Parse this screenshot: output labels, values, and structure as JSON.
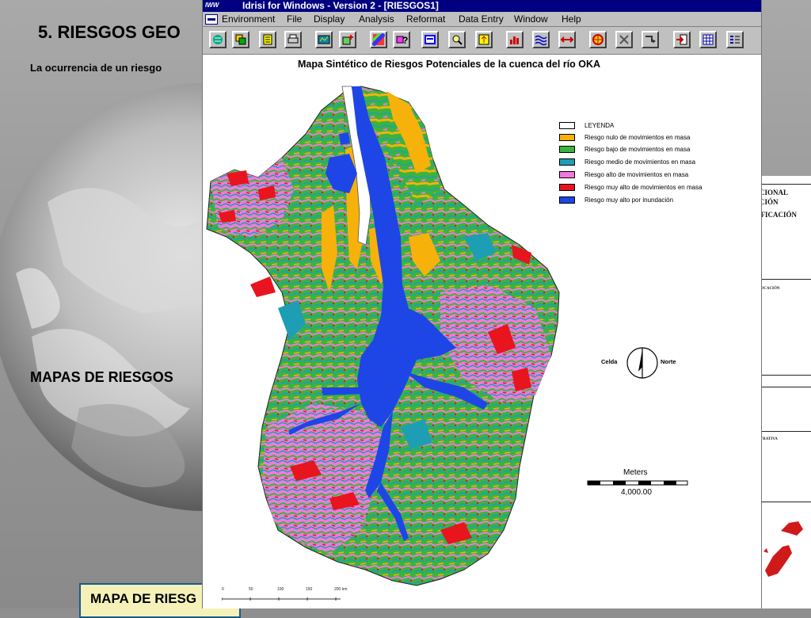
{
  "slide": {
    "title": "5. RIESGOS GEO",
    "intro": "La ocurrencia de un riesgo",
    "heading": "MAPAS DE RIESGOS",
    "bottom_label": "MAPA DE RIESG"
  },
  "window": {
    "title": "Idrisi for Windows - Version 2 - [RIESGOS1]",
    "app_icon_text": "IWW",
    "menus": [
      "Environment",
      "File",
      "Display",
      "Analysis",
      "Reformat",
      "Data Entry",
      "Window",
      "Help"
    ],
    "toolbar_icons": [
      "globe-icon",
      "layers-icon",
      "list-icon",
      "print-icon",
      "map-composition-icon",
      "add-layer-icon",
      "palette-icon",
      "query-icon",
      "window-icon",
      "zoom-icon",
      "pan-icon",
      "histogram-icon",
      "waves-icon",
      "arrows-icon",
      "target-icon",
      "tools-icon",
      "export-icon",
      "import-icon",
      "table-icon",
      "legend-icon"
    ]
  },
  "map": {
    "title": "Mapa Sintético de Riesgos Potenciales de la cuenca del río OKA",
    "legend": [
      {
        "label": "LEYENDA",
        "color": "#ffffff"
      },
      {
        "label": "Riesgo nulo de movimientos en masa",
        "color": "#f6b20a"
      },
      {
        "label": "Riesgo bajo de movimientos en masa",
        "color": "#3cb43c"
      },
      {
        "label": "Riesgo medio de movimientos en masa",
        "color": "#1e9eb4"
      },
      {
        "label": "Riesgo alto de movimientos en masa",
        "color": "#f07adc"
      },
      {
        "label": "Riesgo muy alto de movimientos en masa",
        "color": "#e8141e"
      },
      {
        "label": "Riesgo muy alto por inundación",
        "color": "#1e46e6"
      }
    ],
    "north_left": "Celda",
    "north_right": "Norte",
    "scale_unit": "Meters",
    "scale_value": "4,000.00"
  },
  "back_doc": {
    "line1": "CIONAL",
    "line2": "CIÓN",
    "line3": "IFICACIÓN",
    "box1": "LOCACIÓN",
    "box2": "STRATIVA"
  },
  "bottom_scale": [
    "0",
    "50",
    "100",
    "150",
    "200 km"
  ]
}
